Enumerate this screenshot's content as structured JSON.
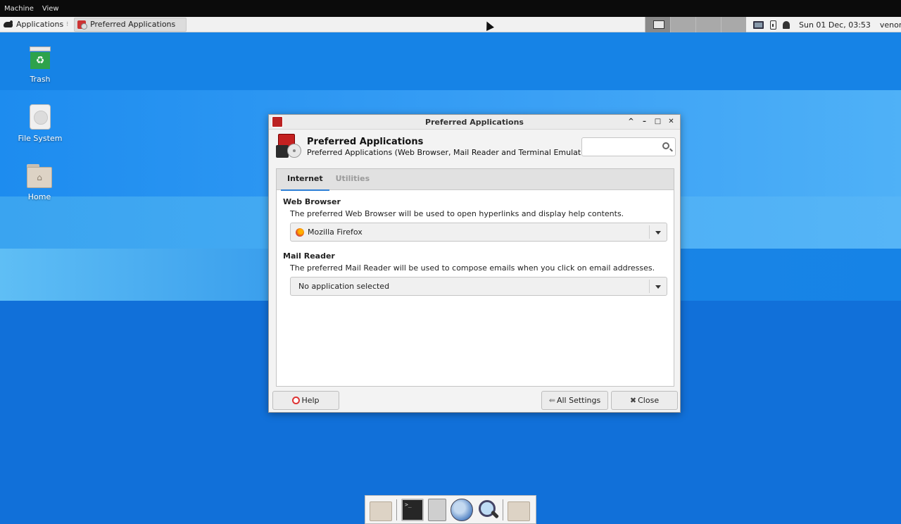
{
  "vm_menu": {
    "items": [
      "Machine",
      "View"
    ]
  },
  "panel": {
    "applications_label": "Applications",
    "separator_glyph": "⁝",
    "task_button_label": "Preferred Applications",
    "clock": "Sun 01 Dec, 03:53",
    "user": "venom"
  },
  "desktop": {
    "icons": [
      {
        "label": "Trash",
        "glyph": "♻"
      },
      {
        "label": "File System"
      },
      {
        "label": "Home",
        "glyph": "⌂"
      }
    ]
  },
  "dialog": {
    "window_title": "Preferred Applications",
    "controls": {
      "shade": "^",
      "minimize": "–",
      "maximize": "□",
      "close": "✕"
    },
    "header_title": "Preferred Applications",
    "header_subtitle": "Preferred Applications (Web Browser, Mail Reader and Terminal Emulator)",
    "search_placeholder": "",
    "tabs": [
      {
        "label": "Internet",
        "active": true
      },
      {
        "label": "Utilities",
        "active": false
      }
    ],
    "sections": [
      {
        "title": "Web Browser",
        "description": "The preferred Web Browser will be used to open hyperlinks and display help contents.",
        "selected": "Mozilla Firefox"
      },
      {
        "title": "Mail Reader",
        "description": "The preferred Mail Reader will be used to compose emails when you click on email addresses.",
        "selected": "No application selected"
      }
    ],
    "buttons": {
      "help": "Help",
      "all_settings": "All Settings",
      "close": "Close",
      "help_icon": "lifebuoy-icon",
      "all_settings_glyph": "⇚",
      "close_glyph": "✖"
    }
  },
  "dock": {
    "items": [
      "folder-icon",
      "terminal-icon",
      "file-cabinet-icon",
      "web-browser-icon",
      "app-finder-icon",
      "folder-icon"
    ]
  }
}
